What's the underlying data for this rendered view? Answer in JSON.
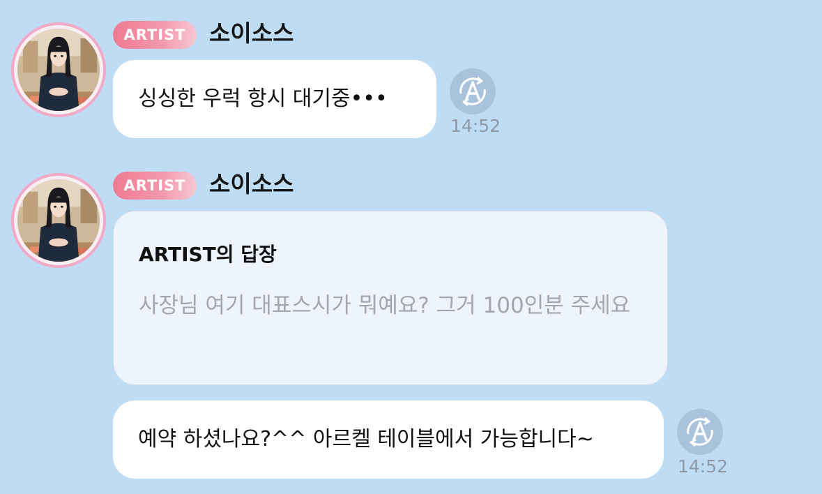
{
  "messages": [
    {
      "badge": "ARTIST",
      "sender": "소이소스",
      "text": "싱싱한 우럭 항시 대기중•••",
      "time": "14:52"
    },
    {
      "badge": "ARTIST",
      "sender": "소이소스",
      "reply_title": "ARTIST의 답장",
      "reply_quote": "사장님 여기 대표스시가 뭐예요? 그거 100인분 주세요",
      "text": "예약 하셨나요?^^ 아르켈 테이블에서 가능합니다~",
      "time": "14:52"
    }
  ],
  "icons": {
    "translate": "translate-icon",
    "avatar": "artist-avatar"
  },
  "colors": {
    "background": "#bfdcf5",
    "badge": "#ef7a92",
    "avatar_ring": "#f0a9c6",
    "translate_button": "#a9c3dc",
    "time": "#8c9aa8"
  }
}
